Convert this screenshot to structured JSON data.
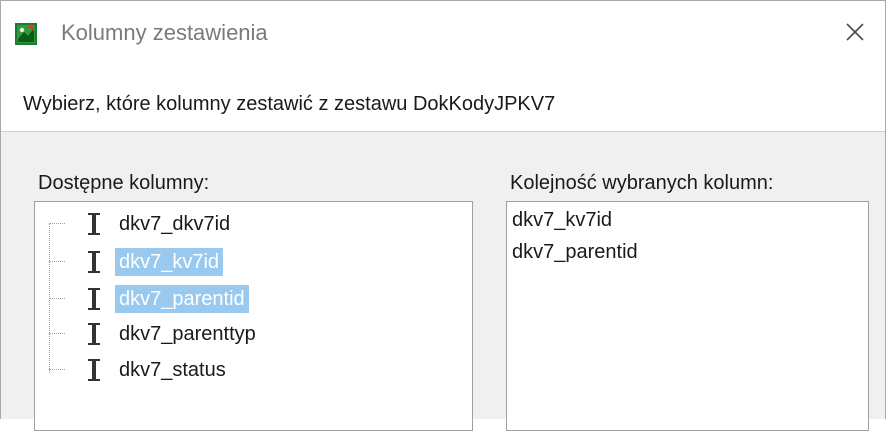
{
  "window": {
    "title": "Kolumny zestawienia",
    "instruction": "Wybierz, które kolumny zestawić z zestawu DokKodyJPKV7"
  },
  "available": {
    "label": "Dostępne kolumny:",
    "items": [
      {
        "label": "dkv7_dkv7id",
        "selected": false
      },
      {
        "label": "dkv7_kv7id",
        "selected": true
      },
      {
        "label": "dkv7_parentid",
        "selected": true
      },
      {
        "label": "dkv7_parenttyp",
        "selected": false
      },
      {
        "label": "dkv7_status",
        "selected": false
      }
    ]
  },
  "selected_order": {
    "label": "Kolejność wybranych kolumn:",
    "items": [
      "dkv7_kv7id",
      "dkv7_parentid"
    ]
  },
  "colors": {
    "selection": "#99c9ef",
    "dialog_bg": "#f0f0f0"
  }
}
